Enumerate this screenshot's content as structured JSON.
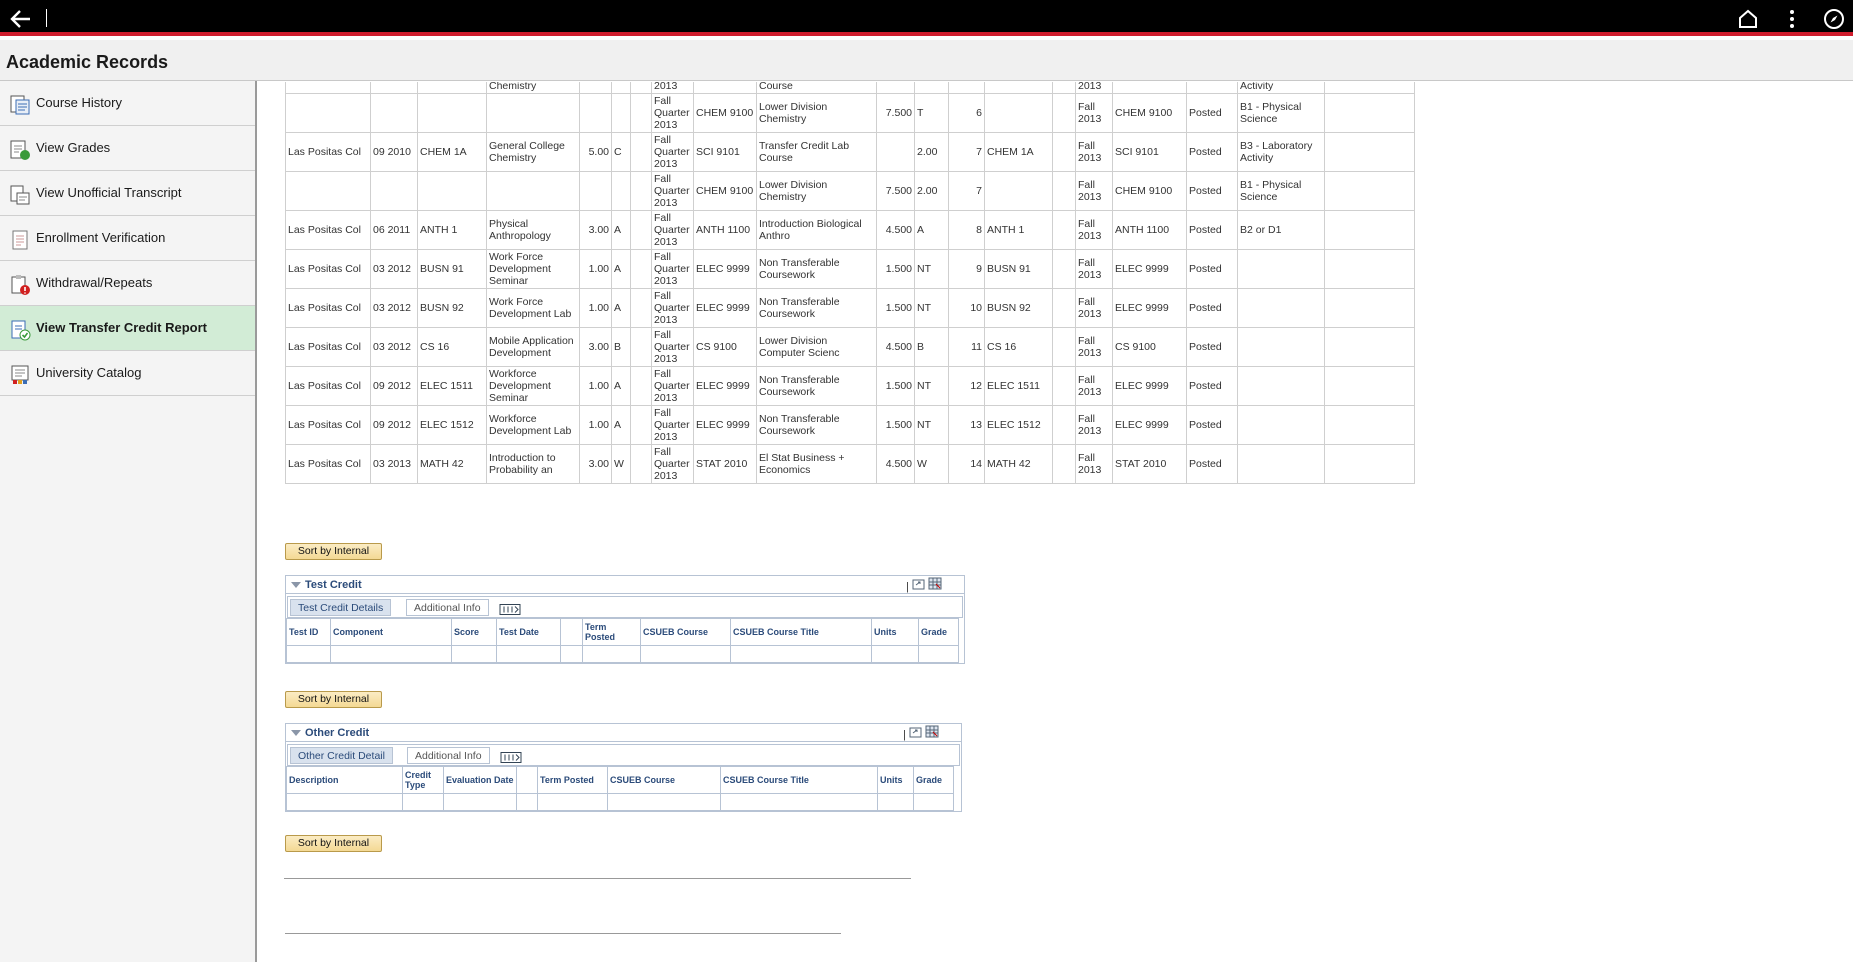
{
  "app": {
    "title": "Academic Records"
  },
  "topbar": {
    "back_icon": "back-arrow-icon",
    "home_icon": "home-icon",
    "menu_icon": "more-vert-icon",
    "compass_icon": "compass-icon"
  },
  "sidebar": {
    "items": [
      {
        "label": "Course History",
        "icon": "course-history-icon",
        "active": false
      },
      {
        "label": "View Grades",
        "icon": "grades-icon",
        "active": false
      },
      {
        "label": "View Unofficial Transcript",
        "icon": "transcript-icon",
        "active": false
      },
      {
        "label": "Enrollment Verification",
        "icon": "verification-icon",
        "active": false
      },
      {
        "label": "Withdrawal/Repeats",
        "icon": "withdrawal-icon",
        "active": false
      },
      {
        "label": "View Transfer Credit Report",
        "icon": "transfer-report-icon",
        "active": true
      },
      {
        "label": "University Catalog",
        "icon": "catalog-icon",
        "active": false
      }
    ]
  },
  "course_table": {
    "partial_top": [
      "Chemistry",
      "2013",
      "Course",
      "2013",
      "Activity"
    ],
    "rows": [
      [
        "",
        "",
        "",
        "",
        "",
        "",
        "",
        "Fall Quarter 2013",
        "CHEM 9100",
        "Lower Division Chemistry",
        "7.500",
        "T",
        "6",
        "",
        "",
        "Fall 2013",
        "CHEM 9100",
        "Posted",
        "B1 - Physical Science",
        ""
      ],
      [
        "Las Positas Col",
        "09 2010",
        "CHEM 1A",
        "General College Chemistry",
        "5.00",
        "C",
        "",
        "Fall Quarter 2013",
        "SCI 9101",
        "Transfer Credit Lab Course",
        "",
        "2.00",
        "7",
        "CHEM 1A",
        "",
        "Fall 2013",
        "SCI 9101",
        "Posted",
        "B3 - Laboratory Activity",
        ""
      ],
      [
        "",
        "",
        "",
        "",
        "",
        "",
        "",
        "Fall Quarter 2013",
        "CHEM 9100",
        "Lower Division Chemistry",
        "7.500",
        "2.00",
        "7",
        "",
        "",
        "Fall 2013",
        "CHEM 9100",
        "Posted",
        "B1 - Physical Science",
        ""
      ],
      [
        "Las Positas Col",
        "06 2011",
        "ANTH 1",
        "Physical Anthropology",
        "3.00",
        "A",
        "",
        "Fall Quarter 2013",
        "ANTH 1100",
        "Introduction Biological Anthro",
        "4.500",
        "A",
        "8",
        "ANTH 1",
        "",
        "Fall 2013",
        "ANTH 1100",
        "Posted",
        "B2 or D1",
        ""
      ],
      [
        "Las Positas Col",
        "03 2012",
        "BUSN 91",
        "Work Force Development Seminar",
        "1.00",
        "A",
        "",
        "Fall Quarter 2013",
        "ELEC 9999",
        "Non Transferable Coursework",
        "1.500",
        "NT",
        "9",
        "BUSN 91",
        "",
        "Fall 2013",
        "ELEC 9999",
        "Posted",
        "",
        ""
      ],
      [
        "Las Positas Col",
        "03 2012",
        "BUSN 92",
        "Work Force Development Lab",
        "1.00",
        "A",
        "",
        "Fall Quarter 2013",
        "ELEC 9999",
        "Non Transferable Coursework",
        "1.500",
        "NT",
        "10",
        "BUSN 92",
        "",
        "Fall 2013",
        "ELEC 9999",
        "Posted",
        "",
        ""
      ],
      [
        "Las Positas Col",
        "03 2012",
        "CS 16",
        "Mobile Application Development",
        "3.00",
        "B",
        "",
        "Fall Quarter 2013",
        "CS 9100",
        "Lower Division Computer Scienc",
        "4.500",
        "B",
        "11",
        "CS 16",
        "",
        "Fall 2013",
        "CS 9100",
        "Posted",
        "",
        ""
      ],
      [
        "Las Positas Col",
        "09 2012",
        "ELEC 1511",
        "Workforce Development Seminar",
        "1.00",
        "A",
        "",
        "Fall Quarter 2013",
        "ELEC 9999",
        "Non Transferable Coursework",
        "1.500",
        "NT",
        "12",
        "ELEC 1511",
        "",
        "Fall 2013",
        "ELEC 9999",
        "Posted",
        "",
        ""
      ],
      [
        "Las Positas Col",
        "09 2012",
        "ELEC 1512",
        "Workforce Development Lab",
        "1.00",
        "A",
        "",
        "Fall Quarter 2013",
        "ELEC 9999",
        "Non Transferable Coursework",
        "1.500",
        "NT",
        "13",
        "ELEC 1512",
        "",
        "Fall 2013",
        "ELEC 9999",
        "Posted",
        "",
        ""
      ],
      [
        "Las Positas Col",
        "03 2013",
        "MATH 42",
        "Introduction to Probability an",
        "3.00",
        "W",
        "",
        "Fall Quarter 2013",
        "STAT 2010",
        "El Stat Business + Economics",
        "4.500",
        "W",
        "14",
        "MATH 42",
        "",
        "Fall 2013",
        "STAT 2010",
        "Posted",
        "",
        ""
      ]
    ]
  },
  "sort_button": {
    "label": "Sort by Internal"
  },
  "test_credit": {
    "title": "Test Credit",
    "tabs": [
      "Test Credit Details",
      "Additional Info"
    ],
    "headers": [
      "Test ID",
      "Component",
      "Score",
      "Test Date",
      "",
      "Term Posted",
      "CSUEB Course",
      "CSUEB Course Title",
      "Units",
      "Grade"
    ]
  },
  "other_credit": {
    "title": "Other Credit",
    "tabs": [
      "Other Credit Detail",
      "Additional Info"
    ],
    "headers": [
      "Description",
      "Credit Type",
      "Evaluation Date",
      "",
      "Term Posted",
      "CSUEB Course",
      "CSUEB Course Title",
      "Units",
      "Grade"
    ]
  },
  "section_icons": {
    "separator": "|",
    "zoom": "zoom-icon",
    "download": "download-grid-icon",
    "tabs_view": "show-all-columns-icon"
  }
}
